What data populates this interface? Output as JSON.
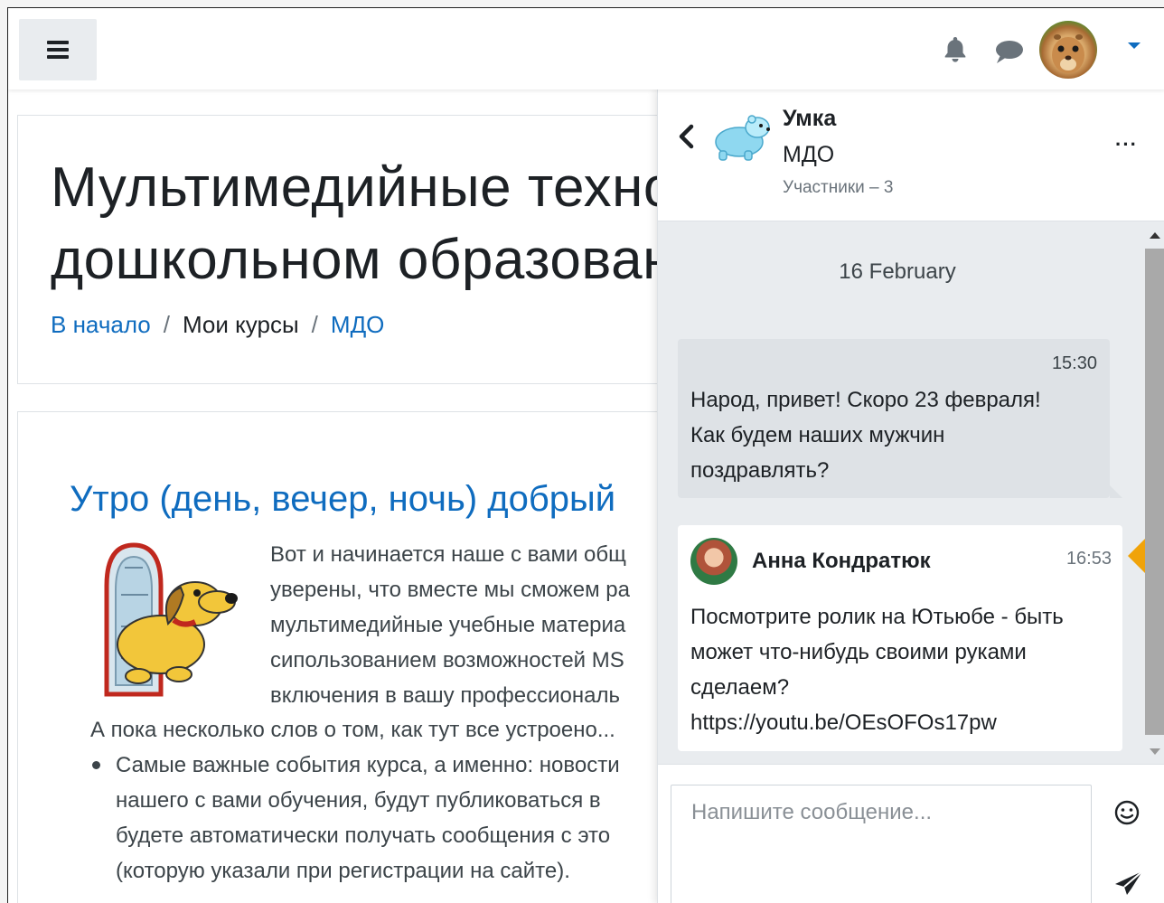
{
  "topbar": {
    "menu_icon": "hamburger-icon",
    "notifications_icon": "bell-icon",
    "messages_icon": "chat-icon",
    "user_menu_icon": "caret-down-icon"
  },
  "course": {
    "title_line1": "Мультимедийные техно",
    "title_line2": "дошкольном образован",
    "breadcrumb": {
      "home": "В начало",
      "sep": "/",
      "my_courses": "Мои курсы",
      "course": "МДО"
    }
  },
  "section": {
    "title": "Утро (день, вечер, ночь) добрый",
    "para_lines": [
      "Вот и начинается наше с вами общ",
      "уверены, что вместе мы сможем ра",
      "мультимедийные учебные материа",
      "сипользованием возможностей MS",
      "включения в вашу профессиональ"
    ],
    "line_after": "А пока несколько слов о том, как тут все устроено...",
    "bullet_lines": [
      "Самые важные события курса, а именно: новости",
      "нашего с вами обучения, будут публиковаться в ",
      "будете автоматически получать сообщения с это",
      "(которую указали при регистрации на сайте)."
    ]
  },
  "conversation": {
    "back_icon": "chevron-left-icon",
    "name": "Умка",
    "subtitle": "МДО",
    "members": "Участники – 3",
    "more": "···",
    "date": "16 February",
    "messages": [
      {
        "time": "15:30",
        "lines": [
          "Народ, привет! Скоро 23 февраля!",
          "Как будем наших мужчин",
          "поздравлять?"
        ]
      },
      {
        "author": "Анна Кондратюк",
        "time": "16:53",
        "lines": [
          "Посмотрите ролик на Ютьюбе - быть",
          "может что-нибудь своими руками",
          "сделаем?",
          "https://youtu.be/OEsOFOs17pw"
        ]
      }
    ],
    "composer_placeholder": "Напишите сообщение...",
    "emoji_icon": "emoji-icon",
    "send_icon": "send-icon"
  },
  "colors": {
    "link": "#0f6cbf",
    "highlight_arrow": "#f0a30a",
    "own_bubble": "#dee2e6",
    "drawer_bg": "#e9ecef"
  }
}
